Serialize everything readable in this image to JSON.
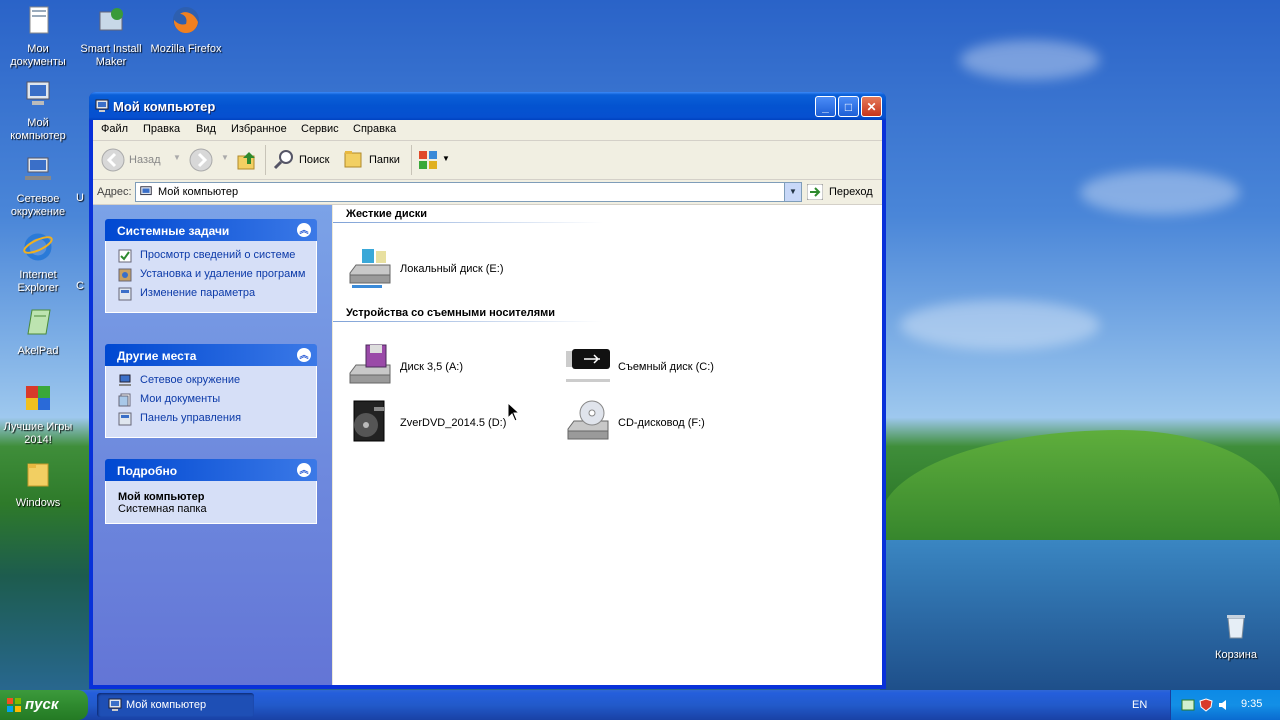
{
  "desktop": {
    "icons": [
      {
        "label": "Мои документы"
      },
      {
        "label": "Smart Install Maker"
      },
      {
        "label": "Mozilla Firefox"
      },
      {
        "label": "Мой компьютер"
      },
      {
        "label": "Сетевое окружение"
      },
      {
        "label": "Internet Explorer"
      },
      {
        "label": "AkelPad"
      },
      {
        "label": "Лучшие Игры 2014!"
      },
      {
        "label": "Windows"
      },
      {
        "label": "Корзина"
      }
    ],
    "partial_labels": [
      "U",
      "C"
    ]
  },
  "window": {
    "title": "Мой компьютер",
    "menu": [
      "Файл",
      "Правка",
      "Вид",
      "Избранное",
      "Сервис",
      "Справка"
    ],
    "toolbar": {
      "back": "Назад",
      "search": "Поиск",
      "folders": "Папки"
    },
    "address": {
      "label": "Адрес:",
      "value": "Мой компьютер",
      "go": "Переход"
    },
    "panels": {
      "system_tasks": {
        "title": "Системные задачи",
        "items": [
          "Просмотр сведений о системе",
          "Установка и удаление программ",
          "Изменение параметра"
        ]
      },
      "other_places": {
        "title": "Другие места",
        "items": [
          "Сетевое окружение",
          "Мои документы",
          "Панель управления"
        ]
      },
      "details": {
        "title": "Подробно",
        "name": "Мой компьютер",
        "type": "Системная папка"
      }
    },
    "content": {
      "hard_disks_title": "Жесткие диски",
      "removable_title": "Устройства со съемными носителями",
      "drives": {
        "local_e": "Локальный диск (E:)",
        "floppy_a": "Диск 3,5 (A:)",
        "removable_c": "Съемный диск (C:)",
        "dvd_d": "ZverDVD_2014.5 (D:)",
        "cd_f": "CD-дисковод (F:)"
      }
    }
  },
  "taskbar": {
    "start": "пуск",
    "active_task": "Мой компьютер",
    "lang": "EN",
    "clock": "9:35"
  },
  "colors": {
    "title_blue": "#0453d0",
    "link_blue": "#0c3aa8",
    "start_green": "#2f8a2f"
  }
}
